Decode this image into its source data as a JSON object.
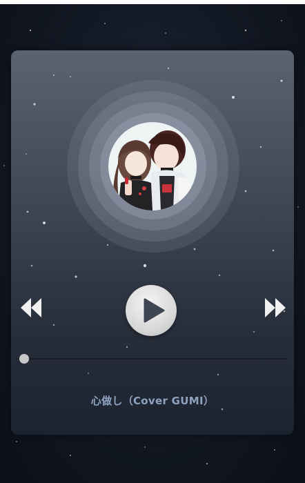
{
  "player": {
    "song_title": "心做し（Cover GUMI）",
    "album_art_icon": "album-cover-anime-duo",
    "prev_icon": "rewind-icon",
    "play_icon": "play-icon",
    "next_icon": "fast-forward-icon",
    "progress_fraction": 0.0
  },
  "colors": {
    "background": "#121823",
    "card_top": "#5b6270",
    "card_bottom": "#1c2330",
    "control_white": "#f0f0f0",
    "title_color": "#8fa3bf"
  }
}
